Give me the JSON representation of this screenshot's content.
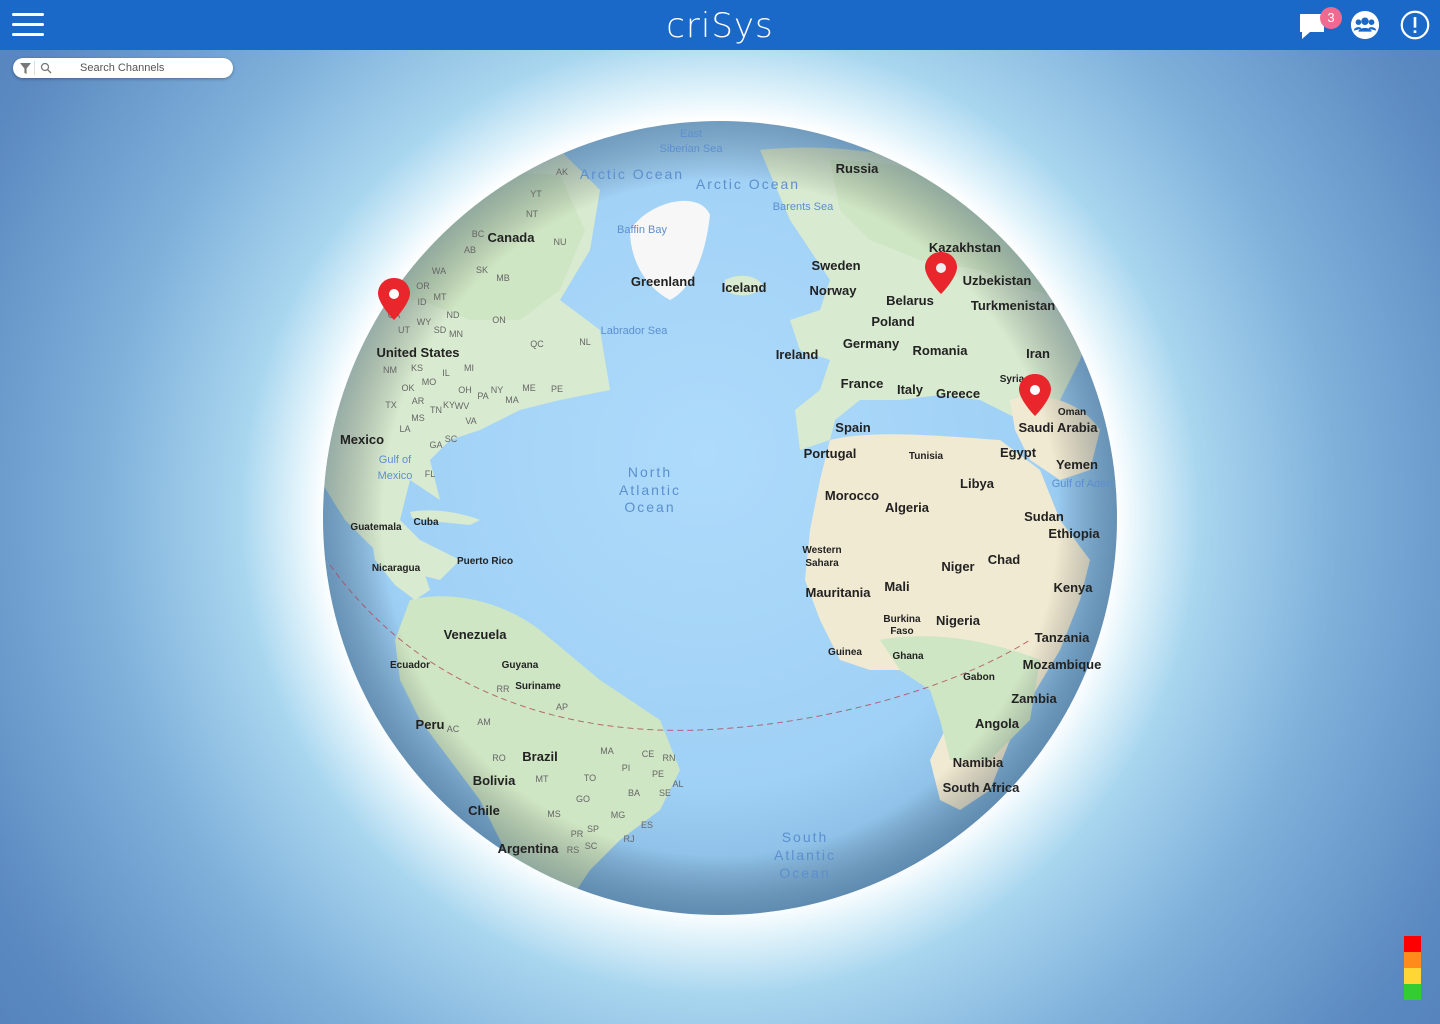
{
  "header": {
    "title": "criSys",
    "notification_count": "3",
    "icons": [
      "hamburger-menu-icon",
      "chat-icon",
      "group-icon",
      "alert-icon"
    ]
  },
  "search": {
    "placeholder": "Search Channels",
    "icons": [
      "filter-icon",
      "search-icon"
    ]
  },
  "map": {
    "oceans": [
      {
        "name": "Arctic Ocean"
      },
      {
        "name": "Arctic Ocean"
      },
      {
        "name": "East"
      },
      {
        "name": "Siberian Sea"
      },
      {
        "name": "Barents Sea"
      },
      {
        "name": "Baffin Bay"
      },
      {
        "name": "Labrador Sea"
      },
      {
        "name": "North"
      },
      {
        "name": "Atlantic"
      },
      {
        "name": "Ocean"
      },
      {
        "name": "South"
      },
      {
        "name": "Atlantic"
      },
      {
        "name": "Ocean"
      },
      {
        "name": "Gulf of"
      },
      {
        "name": "Mexico"
      },
      {
        "name": "Gulf of Aden"
      }
    ],
    "countries": [
      "Russia",
      "Canada",
      "Greenland",
      "Iceland",
      "Sweden",
      "Norway",
      "Kazakhstan",
      "Uzbekistan",
      "Belarus",
      "Turkmenistan",
      "Poland",
      "Germany",
      "Romania",
      "Iran",
      "Ireland",
      "France",
      "Italy",
      "Greece",
      "Syria",
      "Oman",
      "Saudi Arabia",
      "Spain",
      "Portugal",
      "Tunisia",
      "Egypt",
      "Yemen",
      "United States",
      "Mexico",
      "Morocco",
      "Libya",
      "Algeria",
      "Sudan",
      "Ethiopia",
      "Western",
      "Sahara",
      "Chad",
      "Niger",
      "Mauritania",
      "Mali",
      "Kenya",
      "Burkina",
      "Faso",
      "Nigeria",
      "Tanzania",
      "Guinea",
      "Ghana",
      "Mozambique",
      "Gabon",
      "Zambia",
      "Angola",
      "Namibia",
      "South Africa",
      "Guatemala",
      "Cuba",
      "Nicaragua",
      "Puerto Rico",
      "Venezuela",
      "Ecuador",
      "Guyana",
      "Suriname",
      "Peru",
      "Brazil",
      "Bolivia",
      "Chile",
      "Argentina"
    ],
    "regions": [
      "AK",
      "YT",
      "NT",
      "NU",
      "BC",
      "AB",
      "SK",
      "MB",
      "ON",
      "QC",
      "NL",
      "PE",
      "WA",
      "OR",
      "ID",
      "MT",
      "WY",
      "ND",
      "SD",
      "MN",
      "UT",
      "CA",
      "NM",
      "KS",
      "OK",
      "TX",
      "MO",
      "AR",
      "LA",
      "MS",
      "TN",
      "KY",
      "WV",
      "VA",
      "OH",
      "PA",
      "NY",
      "ME",
      "MA",
      "IL",
      "MI",
      "GA",
      "SC",
      "FL",
      "RR",
      "AP",
      "AM",
      "AC",
      "RO",
      "MT",
      "TO",
      "MA",
      "PI",
      "CE",
      "RN",
      "PE",
      "AL",
      "SE",
      "BA",
      "GO",
      "MG",
      "MS",
      "ES",
      "SP",
      "RJ",
      "PR",
      "SC",
      "RS"
    ],
    "markers": [
      {
        "name": "US West Coast"
      },
      {
        "name": "Russia / Kazakhstan"
      },
      {
        "name": "Saudi Arabia"
      }
    ]
  },
  "legend": {
    "colors": [
      "#ff0000",
      "#ff8c1a",
      "#ffd633",
      "#33cc33"
    ]
  }
}
